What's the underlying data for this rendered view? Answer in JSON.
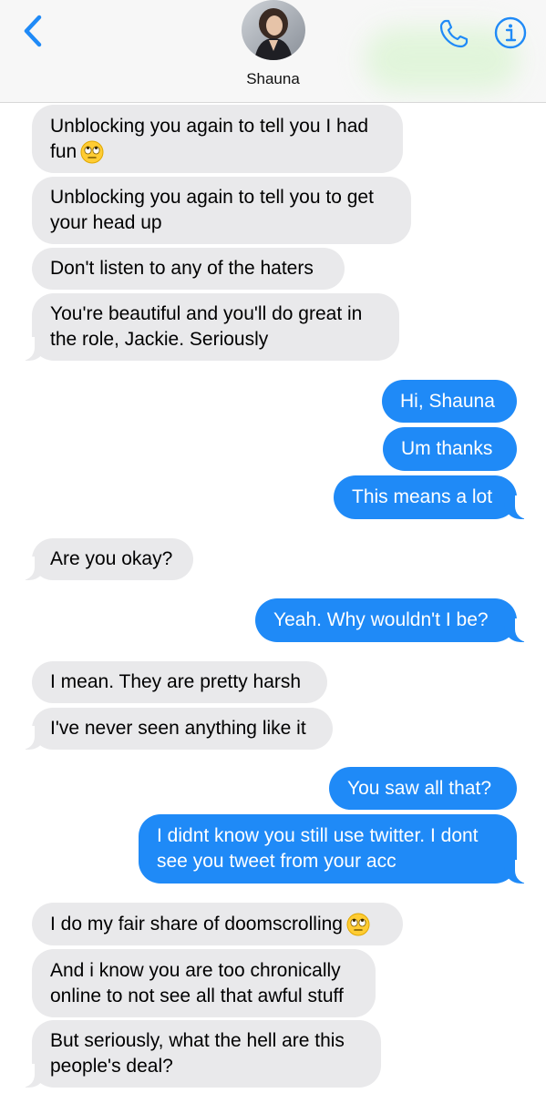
{
  "contact": {
    "name": "Shauna"
  },
  "messages": [
    {
      "id": "m1",
      "text": "Unblocking you again to tell you I had\nfun",
      "emoji": "face-with-rolling-eyes",
      "dir": "in"
    },
    {
      "id": "m2",
      "text": "Unblocking you again to tell you to get\nyour head up",
      "dir": "in"
    },
    {
      "id": "m3",
      "text": "Don't listen to any of the haters",
      "dir": "in"
    },
    {
      "id": "m4",
      "text": "You're beautiful and you'll do great in\nthe role, Jackie. Seriously",
      "dir": "in"
    },
    {
      "id": "m5",
      "text": "Hi, Shauna",
      "dir": "out"
    },
    {
      "id": "m6",
      "text": "Um thanks",
      "dir": "out"
    },
    {
      "id": "m7",
      "text": "This means a lot",
      "dir": "out"
    },
    {
      "id": "m8",
      "text": "Are you okay?",
      "dir": "in"
    },
    {
      "id": "m9",
      "text": "Yeah. Why wouldn't I be?",
      "dir": "out"
    },
    {
      "id": "m10",
      "text": "I mean. They are pretty harsh",
      "dir": "in"
    },
    {
      "id": "m11",
      "text": "I've never seen anything like it",
      "dir": "in"
    },
    {
      "id": "m12",
      "text": "You saw all that?",
      "dir": "out"
    },
    {
      "id": "m13",
      "text": "I didnt know you still use twitter. I dont\nsee you tweet from your acc",
      "dir": "out"
    },
    {
      "id": "m14",
      "text": "I do my fair share of doomscrolling",
      "emoji": "face-with-rolling-eyes",
      "dir": "in"
    },
    {
      "id": "m15",
      "text": "And i know you are too chronically\nonline to not see all that awful stuff",
      "dir": "in"
    },
    {
      "id": "m16",
      "text": "But seriously, what the hell are this\npeople's deal?",
      "dir": "in"
    }
  ],
  "colors": {
    "incoming_bubble": "#e9e9eb",
    "outgoing_bubble": "#1f8af7",
    "accent": "#1f8af7"
  },
  "icons": {
    "back": "chevron-left-icon",
    "call": "phone-icon",
    "info": "info-icon",
    "emoji": "face-with-rolling-eyes"
  }
}
